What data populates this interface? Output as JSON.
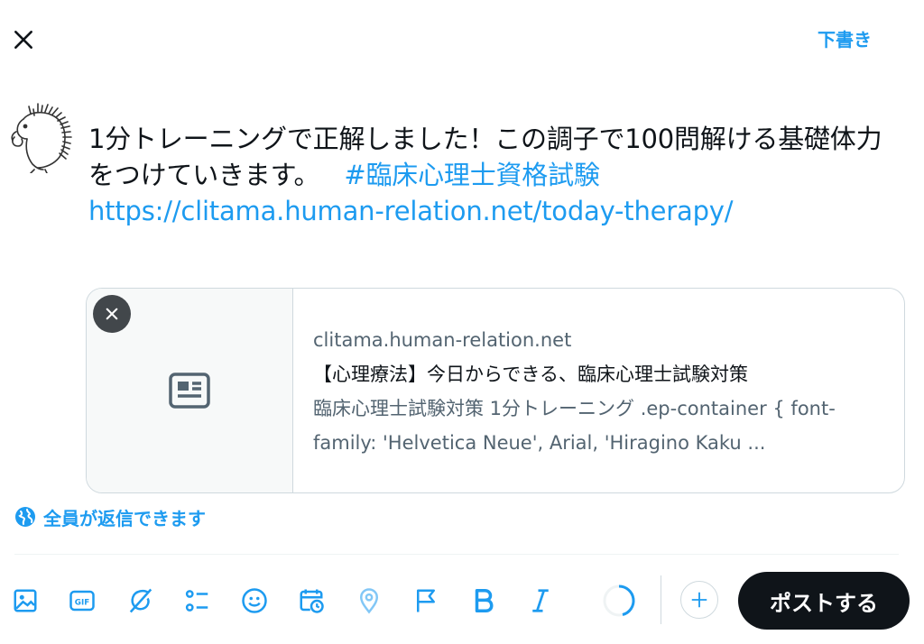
{
  "header": {
    "close_icon": "close-icon",
    "draft_label": "下書き"
  },
  "compose": {
    "text": "1分トレーニングで正解しました！この調子で100問解ける基礎体力をつけていきます。",
    "hashtag": "#臨床心理士資格試験",
    "url": "https://clitama.human-relation.net/today-therapy/"
  },
  "link_card": {
    "domain": "clitama.human-relation.net",
    "title": "【心理療法】今日からできる、臨床心理士試験対策",
    "description": "臨床心理士試験対策 1分トレーニング .ep-container { font-family: 'Helvetica Neue', Arial, 'Hiragino Kaku ...",
    "thumbnail_icon": "article-icon",
    "remove_icon": "close-icon"
  },
  "reply_setting": {
    "icon": "globe-icon",
    "label": "全員が返信できます"
  },
  "toolbar": {
    "icons": [
      "image-icon",
      "gif-icon",
      "grok-icon",
      "poll-icon",
      "emoji-icon",
      "schedule-icon",
      "location-icon",
      "flag-icon",
      "bold-icon",
      "italic-icon"
    ],
    "post_label": "ポストする"
  },
  "colors": {
    "accent": "#1d9bf0",
    "text": "#0f1419",
    "muted": "#536471",
    "border": "#cfd9de",
    "post_button": "#0f1419"
  }
}
